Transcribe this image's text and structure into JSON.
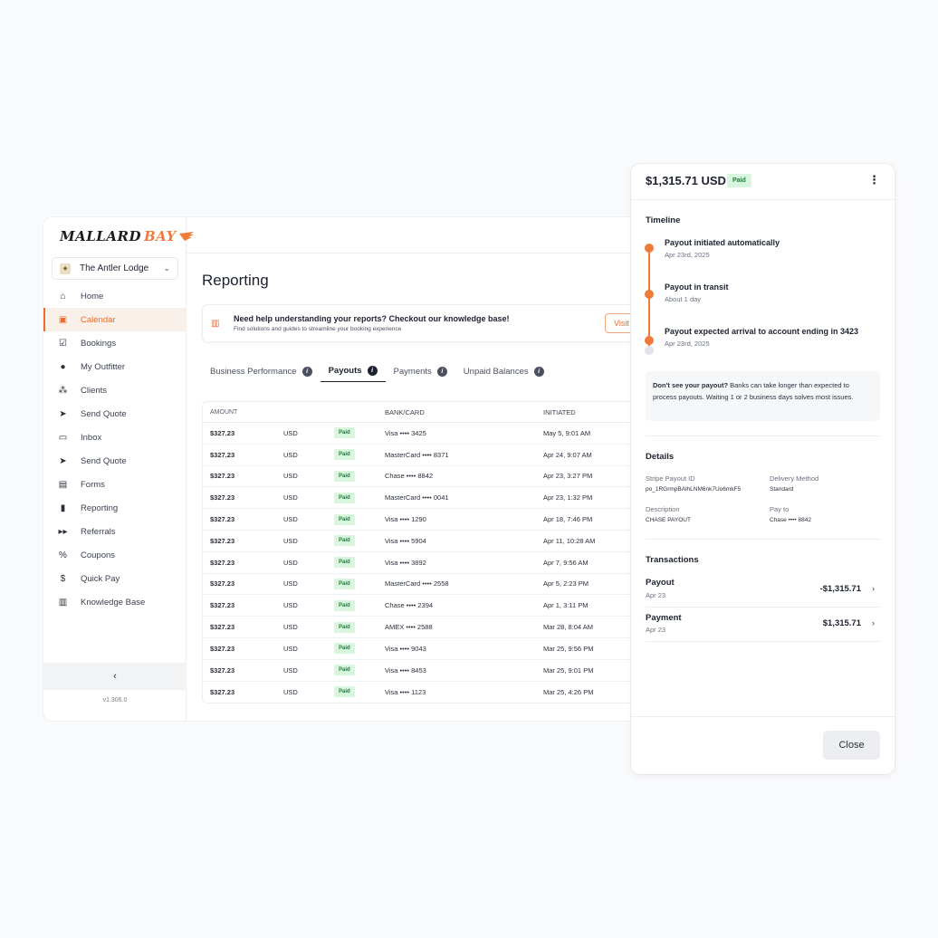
{
  "brand": {
    "word1": "MALLARD",
    "word2": "BAY",
    "accent": "#f06a28"
  },
  "org": {
    "name": "The Antler Lodge"
  },
  "nav": [
    {
      "label": "Home",
      "icon": "⌂",
      "name": "home-icon"
    },
    {
      "label": "Calendar",
      "icon": "▣",
      "name": "calendar-icon",
      "active": true
    },
    {
      "label": "Bookings",
      "icon": "☑",
      "name": "bookings-icon"
    },
    {
      "label": "My Outfitter",
      "icon": "●",
      "name": "user-icon"
    },
    {
      "label": "Clients",
      "icon": "⁂",
      "name": "clients-icon"
    },
    {
      "label": "Send Quote",
      "icon": "➤",
      "name": "send-icon"
    },
    {
      "label": "Inbox",
      "icon": "▭",
      "name": "inbox-icon"
    },
    {
      "label": "Send Quote",
      "icon": "➤",
      "name": "send-icon"
    },
    {
      "label": "Forms",
      "icon": "▤",
      "name": "forms-icon"
    },
    {
      "label": "Reporting",
      "icon": "▮",
      "name": "reporting-icon"
    },
    {
      "label": "Referrals",
      "icon": "▸▸",
      "name": "referrals-icon"
    },
    {
      "label": "Coupons",
      "icon": "%",
      "name": "coupon-icon"
    },
    {
      "label": "Quick Pay",
      "icon": "$",
      "name": "dollar-icon"
    },
    {
      "label": "Knowledge Base",
      "icon": "▥",
      "name": "book-icon"
    }
  ],
  "sidebar_footer": {
    "collapse": "‹",
    "version": "v1.306.0"
  },
  "page": {
    "title": "Reporting"
  },
  "banner": {
    "title": "Need help understanding your reports? Checkout our knowledge base!",
    "subtitle": "Find solutions and guides to streamline your booking experience",
    "button": "Visit"
  },
  "tabs": [
    {
      "label": "Business Performance"
    },
    {
      "label": "Payouts",
      "active": true
    },
    {
      "label": "Payments"
    },
    {
      "label": "Unpaid Balances"
    }
  ],
  "table": {
    "headers": [
      "AMOUNT",
      "",
      "",
      "BANK/CARD",
      "INITIATED"
    ],
    "rows": [
      [
        "$327.23",
        "USD",
        "Paid",
        "Visa •••• 3425",
        "May 5, 9:01 AM"
      ],
      [
        "$327.23",
        "USD",
        "Paid",
        "MasterCard •••• 8371",
        "Apr 24, 9:07 AM"
      ],
      [
        "$327.23",
        "USD",
        "Paid",
        "Chase •••• 8842",
        "Apr 23, 3:27 PM"
      ],
      [
        "$327.23",
        "USD",
        "Paid",
        "MasterCard •••• 0041",
        "Apr 23, 1:32 PM"
      ],
      [
        "$327.23",
        "USD",
        "Paid",
        "Visa •••• 1290",
        "Apr 18, 7:46 PM"
      ],
      [
        "$327.23",
        "USD",
        "Paid",
        "Visa •••• 5904",
        "Apr 11, 10:28 AM"
      ],
      [
        "$327.23",
        "USD",
        "Paid",
        "Visa •••• 3892",
        "Apr 7, 9:56 AM"
      ],
      [
        "$327.23",
        "USD",
        "Paid",
        "MasterCard •••• 2558",
        "Apr 5, 2:23 PM"
      ],
      [
        "$327.23",
        "USD",
        "Paid",
        "Chase •••• 2394",
        "Apr 1, 3:11 PM"
      ],
      [
        "$327.23",
        "USD",
        "Paid",
        "AMEX •••• 2588",
        "Mar 28, 8:04 AM"
      ],
      [
        "$327.23",
        "USD",
        "Paid",
        "Visa •••• 9043",
        "Mar 25, 9:56 PM"
      ],
      [
        "$327.23",
        "USD",
        "Paid",
        "Visa •••• 8453",
        "Mar 25, 9:01 PM"
      ],
      [
        "$327.23",
        "USD",
        "Paid",
        "Visa •••• 1123",
        "Mar 25, 4:26 PM"
      ]
    ]
  },
  "panel": {
    "amount": "$1,315.71 USD",
    "status": "Paid",
    "more": "⋮",
    "timeline_title": "Timeline",
    "timeline": [
      {
        "title": "Payout initiated automatically",
        "sub": "Apr 23rd, 2025"
      },
      {
        "title": "Payout in transit",
        "sub": "About 1 day"
      },
      {
        "title": "Payout expected arrival to account ending in 3423",
        "sub": "Apr 23rd, 2025"
      }
    ],
    "note_bold": "Don't see your payout?",
    "note_text": " Banks can take longer than expected to process payouts. Waiting 1 or 2 business days solves most issues.",
    "details_title": "Details",
    "details": [
      {
        "label": "Stripe Payout ID",
        "value": "po_1RGrmpBAlhLNM6nk7Uo6mkF5"
      },
      {
        "label": "Delivery Method",
        "value": "Standard"
      },
      {
        "label": "Description",
        "value": "CHASE PAYOUT"
      },
      {
        "label": "Pay to",
        "value": "Chase •••• 8842"
      }
    ],
    "transactions_title": "Transactions",
    "transactions": [
      {
        "title": "Payout",
        "date": "Apr 23",
        "amount": "-$1,315.71"
      },
      {
        "title": "Payment",
        "date": "Apr 23",
        "amount": "$1,315.71"
      }
    ],
    "close": "Close"
  }
}
